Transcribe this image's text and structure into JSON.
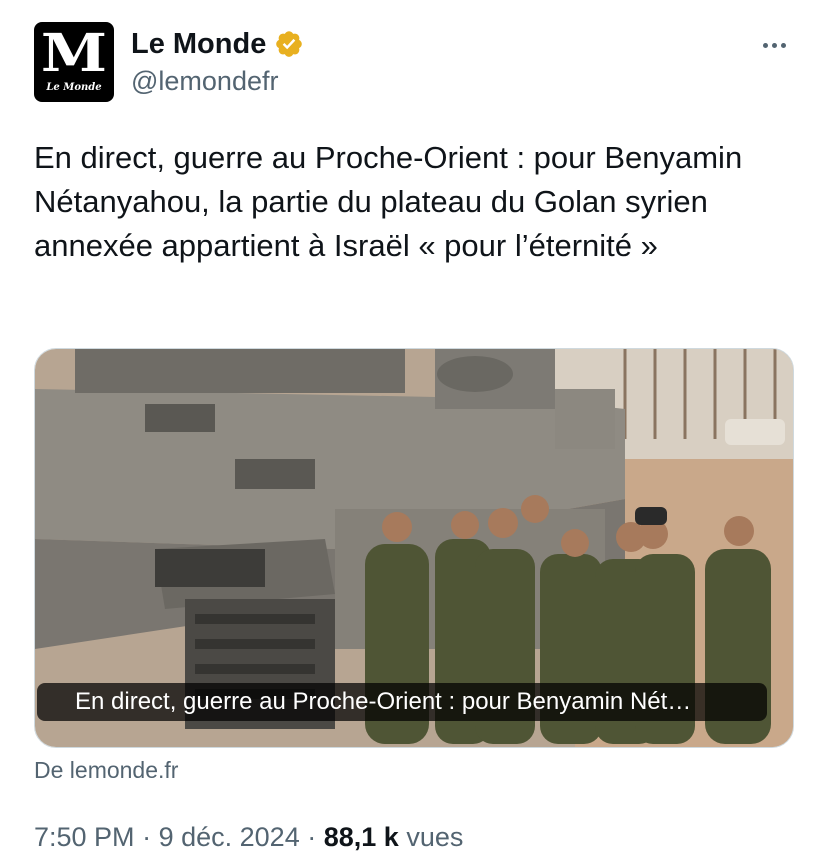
{
  "author": {
    "avatar_monogram": "M",
    "avatar_wordmark": "Le Monde",
    "display_name": "Le Monde",
    "handle": "@lemondefr",
    "verified_icon": "verified-gold-badge-icon",
    "verified_color": "#e8b020"
  },
  "menu": {
    "icon": "more-horizontal-icon"
  },
  "tweet": {
    "text": "En direct, guerre au Proche-Orient : pour Benyamin Nétanyahou, la partie du plateau du Golan syrien annexée appartient à Israël « pour l’éternité »"
  },
  "card": {
    "caption": "En direct, guerre au Proche-Orient : pour Benyamin Nét…",
    "source": "De lemonde.fr"
  },
  "meta": {
    "time": "7:50 PM",
    "separator": "·",
    "date": "9 déc. 2024",
    "views_count": "88,1 k",
    "views_label": "vues"
  },
  "colors": {
    "text": "#0f1419",
    "secondary": "#536471",
    "border": "#cfd9de"
  }
}
